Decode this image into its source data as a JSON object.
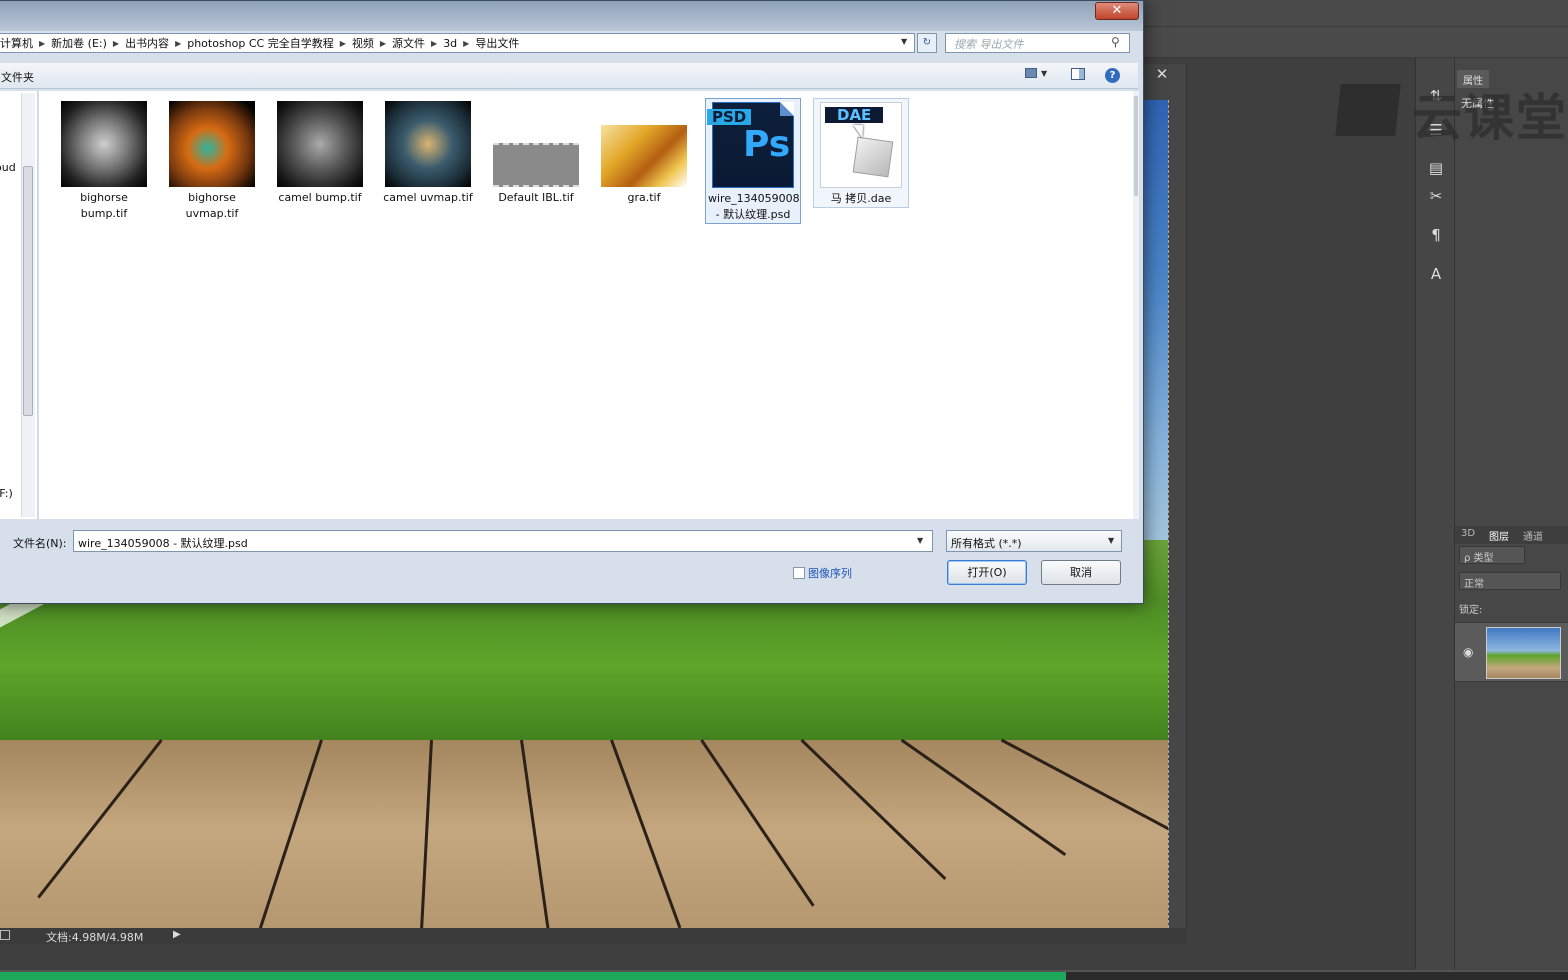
{
  "dialog": {
    "breadcrumbs": [
      "计算机",
      "新加卷 (E:)",
      "出书内容",
      "photoshop CC 完全自学教程",
      "视频",
      "源文件",
      "3d",
      "导出文件"
    ],
    "search_placeholder": "搜索 导出文件",
    "toolbar_new_folder": "文件夹",
    "nav_items": [
      "oud",
      "(F:)"
    ],
    "files": [
      {
        "name": "bighorse bump.tif",
        "thumb": "bump1"
      },
      {
        "name": "bighorse uvmap.tif",
        "thumb": "uv1"
      },
      {
        "name": "camel bump.tif",
        "thumb": "bump2"
      },
      {
        "name": "camel uvmap.tif",
        "thumb": "uv2"
      },
      {
        "name": "Default IBL.tif",
        "thumb": "ibl"
      },
      {
        "name": "gra.tif",
        "thumb": "gra"
      },
      {
        "name": "wire_134059008 - 默认纹理.psd",
        "thumb": "psd",
        "tag": "PSD",
        "glyph": "Ps",
        "state": "selected"
      },
      {
        "name": "马 拷贝.dae",
        "thumb": "dae",
        "tag": "DAE",
        "state": "hovered"
      }
    ],
    "filename_label": "文件名(N):",
    "filename_value": "wire_134059008 - 默认纹理.psd",
    "filter_value": "所有格式 (*.*)",
    "image_sequence_label": "图像序列",
    "open_button": "打开(O)",
    "cancel_button": "取消",
    "close_glyph": "✕"
  },
  "photoshop": {
    "status_doc_size": "文档:4.98M/4.98M",
    "properties_tab": "属性",
    "properties_title": "无属性",
    "watermark": "云课堂",
    "layers_tabs": [
      "3D",
      "图层",
      "通道"
    ],
    "layer_filter": "ρ 类型",
    "blend_mode": "正常",
    "lock_label": "锁定:",
    "progress_fraction": 0.68,
    "progress_color": "#1ea85c"
  }
}
